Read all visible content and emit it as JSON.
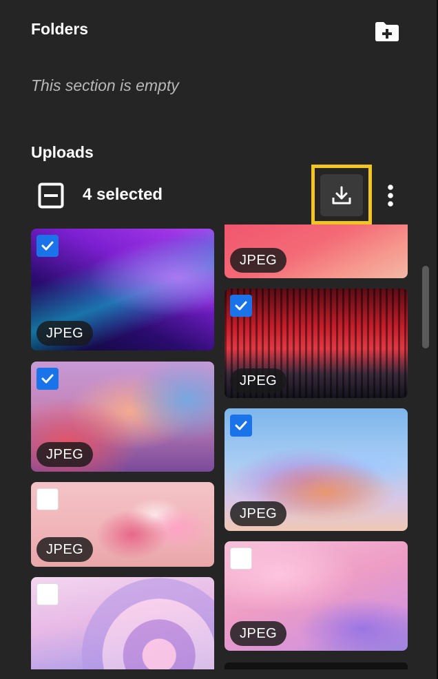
{
  "folders": {
    "title": "Folders",
    "empty_text": "This section is empty",
    "new_folder_icon": "folder-plus-icon"
  },
  "uploads": {
    "title": "Uploads",
    "selected_count": "4 selected",
    "select_toggle_icon": "deselect-minus-icon",
    "download_icon": "download-icon",
    "more_icon": "more-vertical-icon"
  },
  "colors": {
    "background": "#252525",
    "checkbox_checked": "#1a73e8",
    "highlight": "#f3c522"
  },
  "items": [
    {
      "label": "JPEG",
      "checked": false,
      "image": "pink-gradient"
    },
    {
      "label": "JPEG",
      "checked": true,
      "image": "purple-abstract-lines"
    },
    {
      "label": "JPEG",
      "checked": true,
      "image": "red-city-skyline"
    },
    {
      "label": "JPEG",
      "checked": true,
      "image": "pink-blue-gradient"
    },
    {
      "label": "JPEG",
      "checked": true,
      "image": "glass-wave-sky"
    },
    {
      "label": "JPEG",
      "checked": false,
      "image": "glass-shapes-pink"
    },
    {
      "label": "JPEG",
      "checked": false,
      "image": "pink-purple-cloudy"
    },
    {
      "label": "",
      "checked": false,
      "image": "pink-circles"
    }
  ]
}
